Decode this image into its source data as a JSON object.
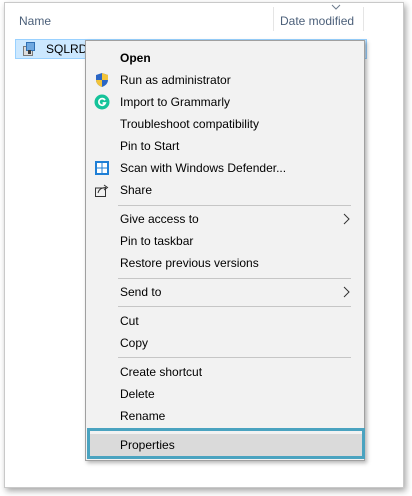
{
  "columns": {
    "name": "Name",
    "date_modified": "Date modified"
  },
  "file": {
    "name": "SQLRD",
    "icon": "installer-icon"
  },
  "menu": {
    "items": [
      {
        "label": "Open",
        "icon": "",
        "bold": true
      },
      {
        "label": "Run as administrator",
        "icon": "uac-shield-icon"
      },
      {
        "label": "Import to Grammarly",
        "icon": "grammarly-icon"
      },
      {
        "label": "Troubleshoot compatibility",
        "icon": ""
      },
      {
        "label": "Pin to Start",
        "icon": ""
      },
      {
        "label": "Scan with Windows Defender...",
        "icon": "windows-defender-icon"
      },
      {
        "label": "Share",
        "icon": "share-icon"
      },
      {
        "label": "Give access to",
        "icon": "",
        "submenu": true
      },
      {
        "label": "Pin to taskbar",
        "icon": ""
      },
      {
        "label": "Restore previous versions",
        "icon": ""
      },
      {
        "label": "Send to",
        "icon": "",
        "submenu": true
      },
      {
        "label": "Cut",
        "icon": ""
      },
      {
        "label": "Copy",
        "icon": ""
      },
      {
        "label": "Create shortcut",
        "icon": ""
      },
      {
        "label": "Delete",
        "icon": ""
      },
      {
        "label": "Rename",
        "icon": ""
      },
      {
        "label": "Properties",
        "icon": "",
        "highlighted": true
      }
    ]
  },
  "colors": {
    "selection": "#cce8ff",
    "menu_background": "#f2f2f2",
    "callout_border": "#4aa3c0",
    "header_text": "#4c607a"
  }
}
